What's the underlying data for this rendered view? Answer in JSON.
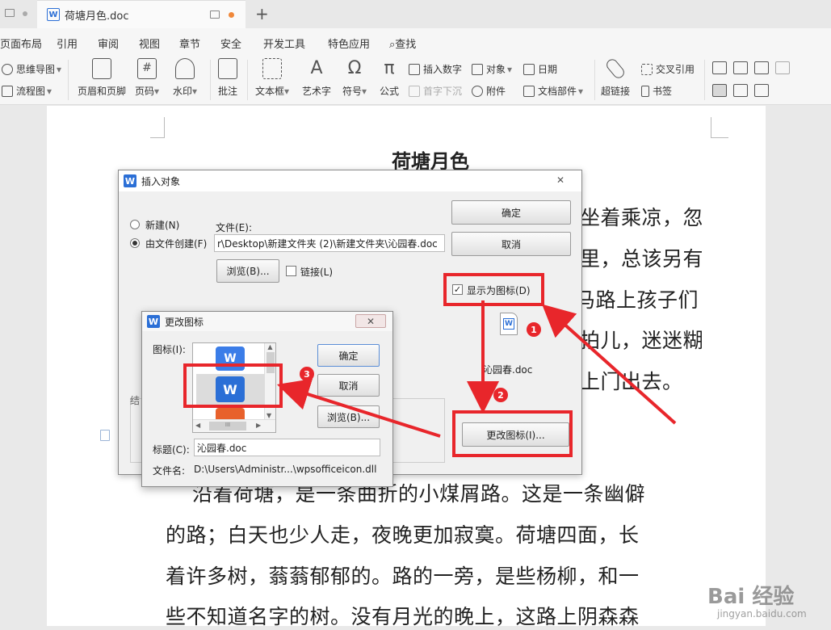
{
  "tabbar": {
    "doc_tab_title": "荷塘月色.doc",
    "plus": "+",
    "doc_icon_letter": "W"
  },
  "menu": {
    "items": [
      "页面布局",
      "引用",
      "审阅",
      "视图",
      "章节",
      "安全",
      "开发工具",
      "特色应用"
    ],
    "search_label": "查找",
    "search_glyph": "⌕"
  },
  "ribbon": {
    "mindmap": "思维导图",
    "flowchart": "流程图",
    "header_footer": "页眉和页脚",
    "page_number": "页码",
    "watermark": "水印",
    "comment": "批注",
    "textbox": "文本框",
    "wordart": "艺术字",
    "symbol": "符号",
    "formula": "公式",
    "insert_number": "插入数字",
    "object": "对象",
    "date": "日期",
    "dropcap": "首字下沉",
    "attachment": "附件",
    "doc_parts": "文档部件",
    "hyperlink": "超链接",
    "cross_ref": "交叉引用",
    "bookmark": "书签",
    "dropdown_glyph": "▾",
    "symbol_glyph": "Ω",
    "formula_glyph": "π",
    "hash_glyph": "#",
    "wordart_glyph": "A"
  },
  "document": {
    "title": "荷塘月色",
    "lines_right": [
      "坐着乘凉，忽",
      "里，总该另有",
      "马路上孩子们",
      "拍儿，迷迷糊",
      "上门出去。"
    ],
    "lines_bottom": [
      "沿着荷塘，是一条曲折的小煤屑路。这是一条幽僻",
      "的路；白天也少人走，夜晚更加寂寞。荷塘四面，长",
      "着许多树，蓊蓊郁郁的。路的一旁，是些杨柳，和一",
      "些不知道名字的树。没有月光的晚上，这路上阴森森"
    ]
  },
  "dialog_insert_object": {
    "title": "插入对象",
    "close_glyph": "✕",
    "radio_new": "新建(N)",
    "radio_from_file": "由文件创建(F)",
    "file_label": "文件(E):",
    "file_path": "r\\Desktop\\新建文件夹 (2)\\新建文件夹\\沁园春.doc",
    "browse": "浏览(B)...",
    "link": "链接(L)",
    "ok": "确定",
    "cancel": "取消",
    "display_as_icon": "显示为图标(D)",
    "icon_caption": "沁园春.doc",
    "change_icon": "更改图标(I)...",
    "check_glyph": "✓",
    "result_label": "结"
  },
  "dialog_change_icon": {
    "title": "更改图标",
    "close_glyph": "✕",
    "icon_label": "图标(I):",
    "ok": "确定",
    "cancel": "取消",
    "browse": "浏览(B)...",
    "caption_label": "标题(C):",
    "caption_value": "沁园春.doc",
    "filename_label": "文件名:",
    "filename_value": "D:\\Users\\Administr...\\wpsofficeicon.dll",
    "scroll_up": "▲",
    "scroll_down": "▼",
    "scroll_left": "◀",
    "scroll_right": "▶",
    "scroll_thumb": "III"
  },
  "annotations": {
    "badge1": "1",
    "badge2": "2",
    "badge3": "3",
    "color": "#e8262b"
  },
  "watermark": {
    "brand": "Bai 经验",
    "url": "jingyan.baidu.com"
  }
}
